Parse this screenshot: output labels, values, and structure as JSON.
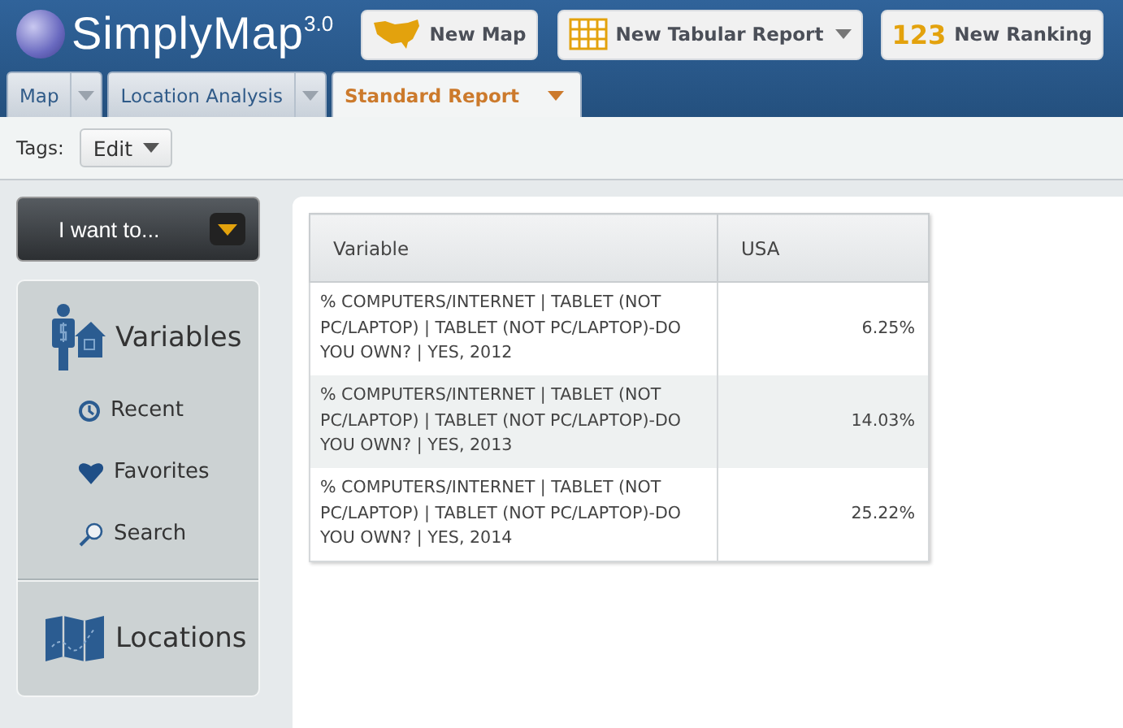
{
  "header": {
    "logo": "SimplyMap",
    "version": "3.0",
    "buttons": [
      {
        "kind": "map",
        "label": "New Map",
        "dropdown": false
      },
      {
        "kind": "grid",
        "label": "New Tabular Report",
        "dropdown": true
      },
      {
        "kind": "ranking",
        "icon_text": "123",
        "label": "New Ranking",
        "dropdown": false
      }
    ]
  },
  "tabs": [
    {
      "label": "Map",
      "selected": false
    },
    {
      "label": "Location Analysis",
      "selected": false
    },
    {
      "label": "Standard Report",
      "selected": true
    }
  ],
  "toolbar": {
    "label": "Tags:",
    "button": "Edit"
  },
  "sidebar": {
    "menu_button": "I want to...",
    "sections": [
      {
        "kind": "variables",
        "label": "Variables",
        "items": [
          {
            "kind": "recent",
            "label": "Recent"
          },
          {
            "kind": "favorites",
            "label": "Favorites"
          },
          {
            "kind": "search",
            "label": "Search"
          }
        ]
      },
      {
        "kind": "locations",
        "label": "Locations"
      }
    ]
  },
  "table": {
    "columns": [
      "Variable",
      "USA"
    ],
    "rows": [
      [
        "% COMPUTERS/INTERNET | TABLET (NOT PC/LAPTOP) | TABLET (NOT PC/LAPTOP)-DO YOU OWN? | YES, 2012",
        "6.25%"
      ],
      [
        "% COMPUTERS/INTERNET | TABLET (NOT PC/LAPTOP) | TABLET (NOT PC/LAPTOP)-DO YOU OWN? | YES, 2013",
        "14.03%"
      ],
      [
        "% COMPUTERS/INTERNET | TABLET (NOT PC/LAPTOP) | TABLET (NOT PC/LAPTOP)-DO YOU OWN? | YES, 2014",
        "25.22%"
      ]
    ]
  }
}
